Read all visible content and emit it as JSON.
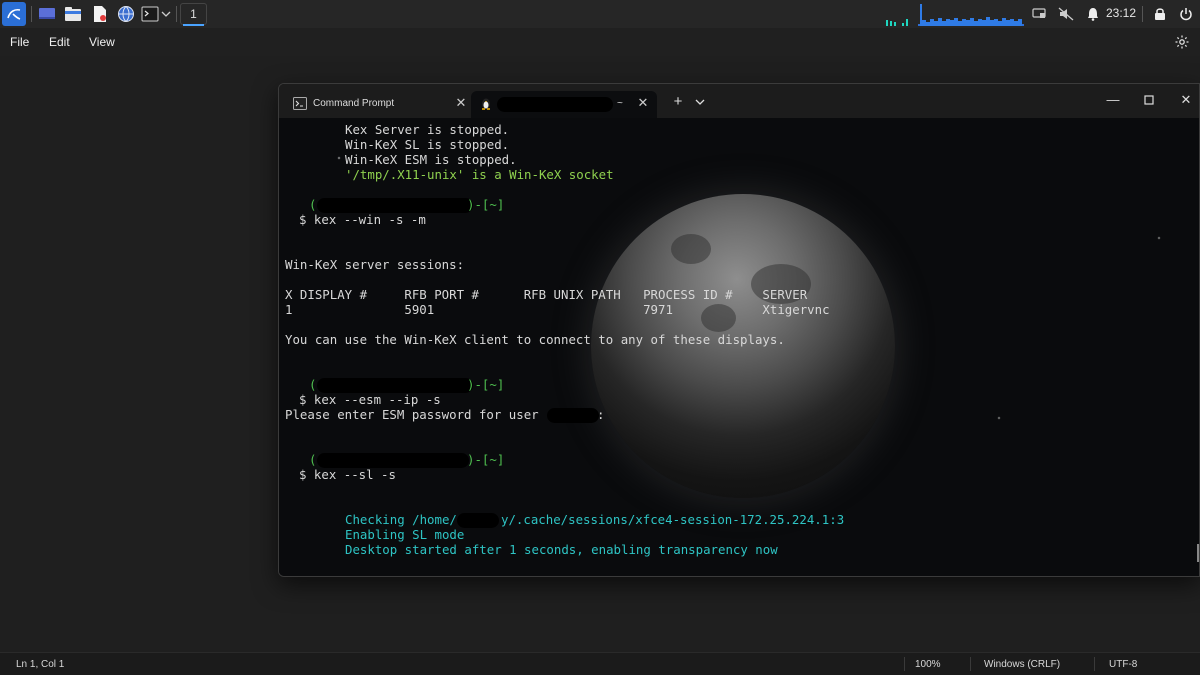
{
  "taskbar": {
    "workspace_label": "1",
    "clock": "23:12"
  },
  "menu": {
    "file": "File",
    "edit": "Edit",
    "view": "View"
  },
  "status": {
    "position": "Ln 1, Col 1",
    "zoom": "100%",
    "line_ending": "Windows (CRLF)",
    "encoding": "UTF-8"
  },
  "terminal": {
    "tabs": [
      {
        "title": "Command Prompt"
      },
      {
        "title_suffix": "~"
      }
    ],
    "lines": {
      "l1": "Kex Server is stopped.",
      "l2": "Win-KeX SL is stopped.",
      "l3": "Win-KeX ESM is stopped.",
      "l4": "'/tmp/.X11-unix' is a Win-KeX socket",
      "p1_open": "(",
      "p1_close": ")-[~]",
      "cmd1": "$ kex --win -s -m",
      "sessions_header": "Win-KeX server sessions:",
      "col_headers": "X DISPLAY #     RFB PORT #      RFB UNIX PATH   PROCESS ID #    SERVER",
      "row1": "1               5901                            7971            Xtigervnc",
      "hint": "You can use the Win-KeX client to connect to any of these displays.",
      "p2_open": "(",
      "p2_close": ")-[~]",
      "cmd2": "$ kex --esm --ip -s",
      "esm_prompt_a": "Please enter ESM password for user",
      "esm_prompt_b": ":",
      "p3_open": "(",
      "p3_close": ")-[~]",
      "cmd3": "$ kex --sl -s",
      "check_a": "Checking /home/",
      "check_b": "y/.cache/sessions/xfce4-session-172.25.224.1:3",
      "sl_mode": "Enabling SL mode",
      "desktop": "Desktop started after 1 seconds, enabling transparency now"
    }
  },
  "colors": {
    "green": "#8fd14f",
    "cyan": "#2ec4c4",
    "prompt": "#4fbf4f",
    "accent": "#4aa3ff"
  }
}
